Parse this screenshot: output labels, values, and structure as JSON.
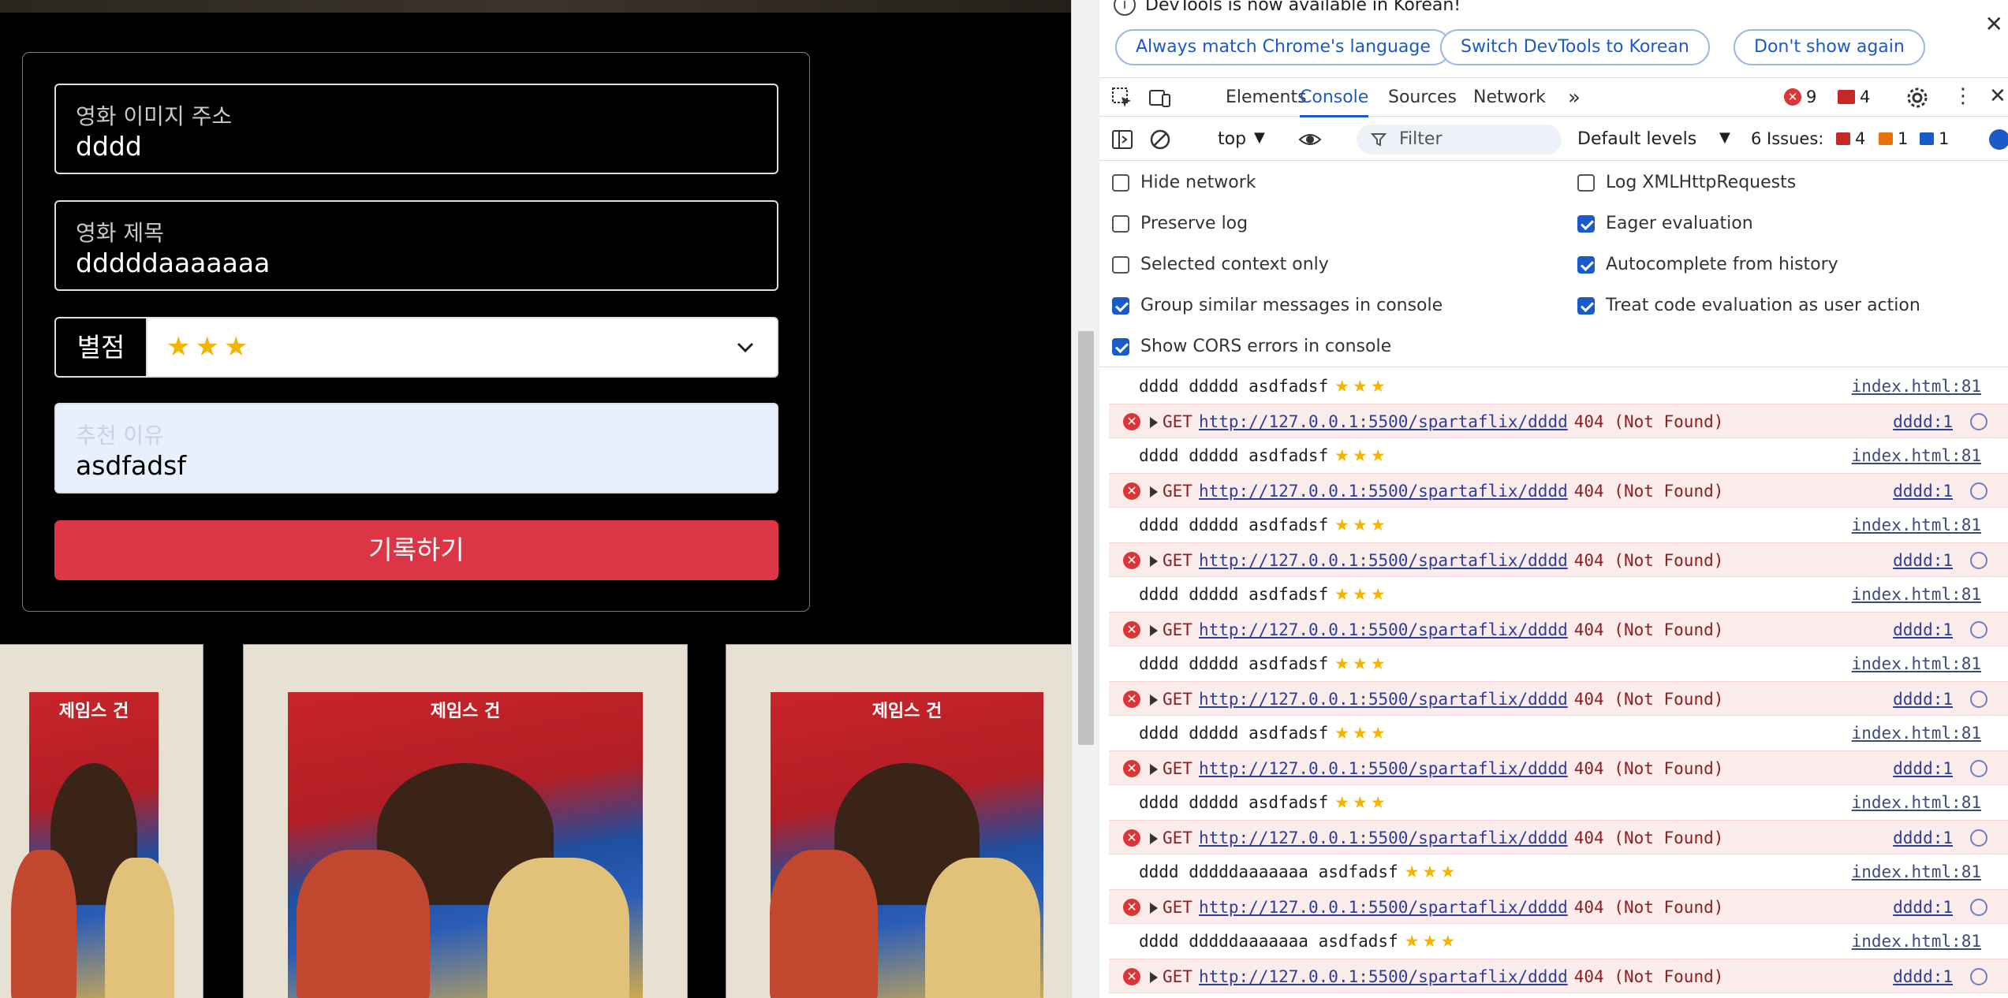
{
  "form": {
    "image_url_label": "영화 이미지 주소",
    "image_url_value": "dddd",
    "title_label": "영화 제목",
    "title_value": "dddddaaaaaaa",
    "rating_label": "별점",
    "rating_stars": "★★★",
    "reason_label": "추천 이유",
    "reason_value": "asdfadsf",
    "submit_label": "기록하기"
  },
  "posters": [
    {
      "title": "제임스 건"
    },
    {
      "title": "제임스 건"
    },
    {
      "title": "제임스 건"
    }
  ],
  "devtools": {
    "info_text": "DevTools is now available in Korean!",
    "btn_match": "Always match Chrome's language",
    "btn_switch": "Switch DevTools to Korean",
    "btn_dont": "Don't show again",
    "tabs": {
      "elements": "Elements",
      "console": "Console",
      "sources": "Sources",
      "network": "Network"
    },
    "error_count": "9",
    "warning_count": "4",
    "context": "top",
    "filter_placeholder": "Filter",
    "levels": "Default levels",
    "issues_label": "6 Issues:",
    "issues_errors": "4",
    "issues_warnings": "1",
    "issues_info": "1",
    "settings": {
      "hide_network": "Hide network",
      "preserve_log": "Preserve log",
      "selected_context": "Selected context only",
      "group_similar": "Group similar messages in console",
      "show_cors": "Show CORS errors in console",
      "log_xhr": "Log XMLHttpRequests",
      "eager_eval": "Eager evaluation",
      "autocomplete": "Autocomplete from history",
      "treat_code": "Treat code evaluation as user action"
    },
    "messages": [
      {
        "type": "log",
        "text": "dddd ddddd asdfadsf",
        "stars": "★★★",
        "source": "index.html:81"
      },
      {
        "type": "error",
        "verb": "GET",
        "url": "http://127.0.0.1:5500/spartaflix/dddd",
        "status": "404 (Not Found)",
        "source": "dddd:1"
      },
      {
        "type": "log",
        "text": "dddd ddddd asdfadsf",
        "stars": "★★★",
        "source": "index.html:81"
      },
      {
        "type": "error",
        "verb": "GET",
        "url": "http://127.0.0.1:5500/spartaflix/dddd",
        "status": "404 (Not Found)",
        "source": "dddd:1"
      },
      {
        "type": "log",
        "text": "dddd ddddd asdfadsf",
        "stars": "★★★",
        "source": "index.html:81"
      },
      {
        "type": "error",
        "verb": "GET",
        "url": "http://127.0.0.1:5500/spartaflix/dddd",
        "status": "404 (Not Found)",
        "source": "dddd:1"
      },
      {
        "type": "log",
        "text": "dddd ddddd asdfadsf",
        "stars": "★★★",
        "source": "index.html:81"
      },
      {
        "type": "error",
        "verb": "GET",
        "url": "http://127.0.0.1:5500/spartaflix/dddd",
        "status": "404 (Not Found)",
        "source": "dddd:1"
      },
      {
        "type": "log",
        "text": "dddd ddddd asdfadsf",
        "stars": "★★★",
        "source": "index.html:81"
      },
      {
        "type": "error",
        "verb": "GET",
        "url": "http://127.0.0.1:5500/spartaflix/dddd",
        "status": "404 (Not Found)",
        "source": "dddd:1"
      },
      {
        "type": "log",
        "text": "dddd ddddd asdfadsf",
        "stars": "★★★",
        "source": "index.html:81"
      },
      {
        "type": "error",
        "verb": "GET",
        "url": "http://127.0.0.1:5500/spartaflix/dddd",
        "status": "404 (Not Found)",
        "source": "dddd:1"
      },
      {
        "type": "log",
        "text": "dddd ddddd asdfadsf",
        "stars": "★★★",
        "source": "index.html:81"
      },
      {
        "type": "error",
        "verb": "GET",
        "url": "http://127.0.0.1:5500/spartaflix/dddd",
        "status": "404 (Not Found)",
        "source": "dddd:1"
      },
      {
        "type": "log",
        "text": "dddd dddddaaaaaaa asdfadsf",
        "stars": "★★★",
        "source": "index.html:81"
      },
      {
        "type": "error",
        "verb": "GET",
        "url": "http://127.0.0.1:5500/spartaflix/dddd",
        "status": "404 (Not Found)",
        "source": "dddd:1"
      },
      {
        "type": "log",
        "text": "dddd dddddaaaaaaa asdfadsf",
        "stars": "★★★",
        "source": "index.html:81"
      },
      {
        "type": "error",
        "verb": "GET",
        "url": "http://127.0.0.1:5500/spartaflix/dddd",
        "status": "404 (Not Found)",
        "source": "dddd:1"
      }
    ]
  }
}
